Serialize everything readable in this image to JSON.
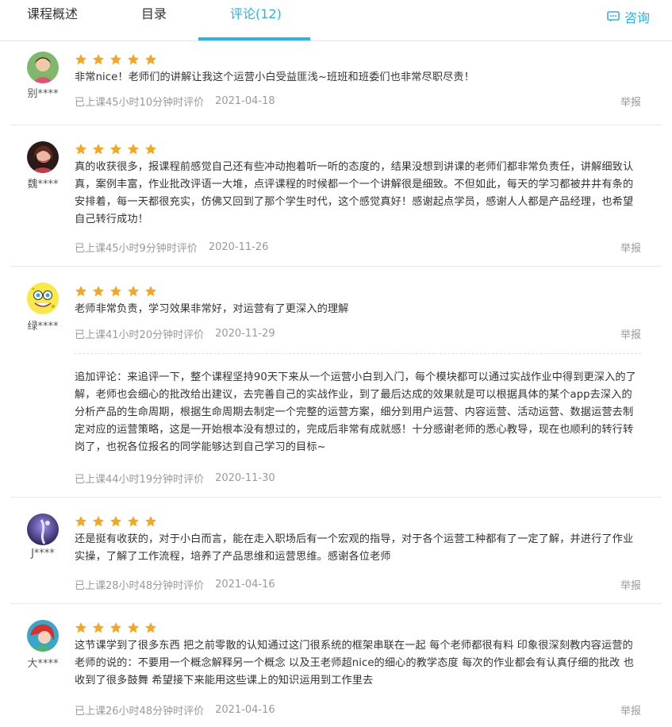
{
  "tabs": [
    {
      "label": "课程概述"
    },
    {
      "label": "目录"
    },
    {
      "label": "评论(12)"
    }
  ],
  "consult": {
    "label": "咨询",
    "icon": "chat-icon"
  },
  "accent_color": "#2bb2f0",
  "star_color": "#f5a623",
  "reviews": [
    {
      "username": "别****",
      "stars": 5,
      "text": "非常nice！老师们的讲解让我这个运营小白受益匪浅~班班和班委们也非常尽职尽责！",
      "meta": "已上课45小时10分钟时评价",
      "date": "2021-04-18",
      "report": "举报"
    },
    {
      "username": "魏****",
      "stars": 5,
      "text": "真的收获很多，报课程前感觉自己还有些冲动抱着听一听的态度的，结果没想到讲课的老师们都非常负责任，讲解细致认真，案例丰富，作业批改评语一大堆，点评课程的时候都一个一个讲解很是细致。不但如此，每天的学习都被井井有条的安排着，每一天都很充实，仿佛又回到了那个学生时代，这个感觉真好！感谢起点学员，感谢人人都是产品经理，也希望自己转行成功！",
      "meta": "已上课45小时9分钟时评价",
      "date": "2020-11-26",
      "report": "举报"
    },
    {
      "username": "绿****",
      "stars": 5,
      "text": "老师非常负责，学习效果非常好，对运营有了更深入的理解",
      "meta": "已上课41小时20分钟时评价",
      "date": "2020-11-29",
      "report": "举报",
      "addon": {
        "text": "追加评论：来追评一下，整个课程坚持90天下来从一个运营小白到入门，每个模块都可以通过实战作业中得到更深入的了解，老师也会细心的批改给出建议，去完善自己的实战作业，到了最后达成的效果就是可以根据具体的某个app去深入的分析产品的生命周期，根据生命周期去制定一个完整的运营方案，细分到用户运营、内容运营、活动运营、数据运营去制定对应的运营策略，这是一开始根本没有想过的，完成后非常有成就感！十分感谢老师的悉心教导，现在也顺利的转行转岗了，也祝各位报名的同学能够达到自己学习的目标~",
        "meta": "已上课44小时19分钟时评价",
        "date": "2020-11-30"
      }
    },
    {
      "username": "J****",
      "stars": 5,
      "text": "还是挺有收获的，对于小白而言，能在走入职场后有一个宏观的指导，对于各个运营工种都有了一定了解，并进行了作业实操，了解了工作流程，培养了产品思维和运营思维。感谢各位老师",
      "meta": "已上课28小时48分钟时评价",
      "date": "2021-04-16",
      "report": "举报"
    },
    {
      "username": "大****",
      "stars": 5,
      "text": "这节课学到了很多东西 把之前零散的认知通过这门很系统的框架串联在一起 每个老师都很有料 印象很深刻教内容运营的老师的说的：不要用一个概念解释另一个概念 以及王老师超nice的细心的教学态度 每次的作业都会有认真仔细的批改 也收到了很多鼓舞 希望接下来能用这些课上的知识运用到工作里去",
      "meta": "已上课26小时48分钟时评价",
      "date": "2021-04-16",
      "report": "举报"
    }
  ]
}
